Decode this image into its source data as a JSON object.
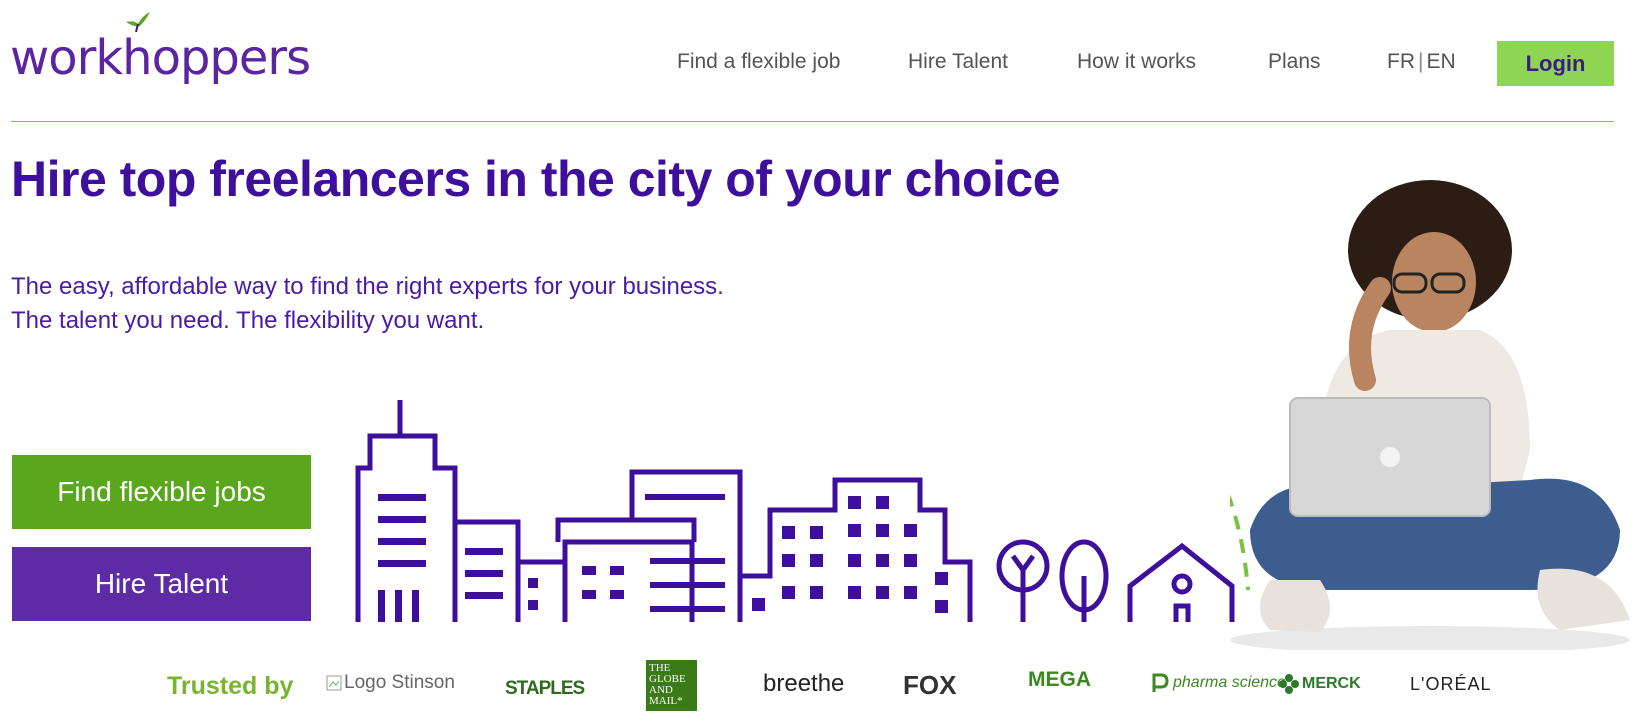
{
  "brand": {
    "name": "workhoppers"
  },
  "nav": {
    "find_job": "Find a flexible job",
    "hire_talent": "Hire Talent",
    "how_it_works": "How it works",
    "plans": "Plans",
    "lang_fr": "FR",
    "lang_sep": "|",
    "lang_en": "EN",
    "login": "Login"
  },
  "hero": {
    "title": "Hire top freelancers in the city of your choice",
    "subtitle_line1": "The easy, affordable way to find the right experts for your business.",
    "subtitle_line2": "The talent you need. The flexibility you want.",
    "cta_jobs": "Find flexible jobs",
    "cta_hire": "Hire Talent"
  },
  "trusted": {
    "label": "Trusted by",
    "logos": {
      "stinson": "Logo Stinson",
      "staples": "STAPLES",
      "globe_lines": [
        "THE",
        "GLOBE",
        "AND",
        "MAIL*"
      ],
      "breethe": "breethe",
      "fox": "FOX",
      "mega": "MEGA",
      "pharma": "pharma science",
      "merck": "MERCK",
      "loreal": "L'ORÉAL"
    }
  },
  "colors": {
    "brand_purple": "#3e0f9c",
    "button_purple": "#5e2ba6",
    "brand_green": "#5aa61c",
    "login_green": "#8ed553",
    "rule_green": "#7ac142"
  }
}
